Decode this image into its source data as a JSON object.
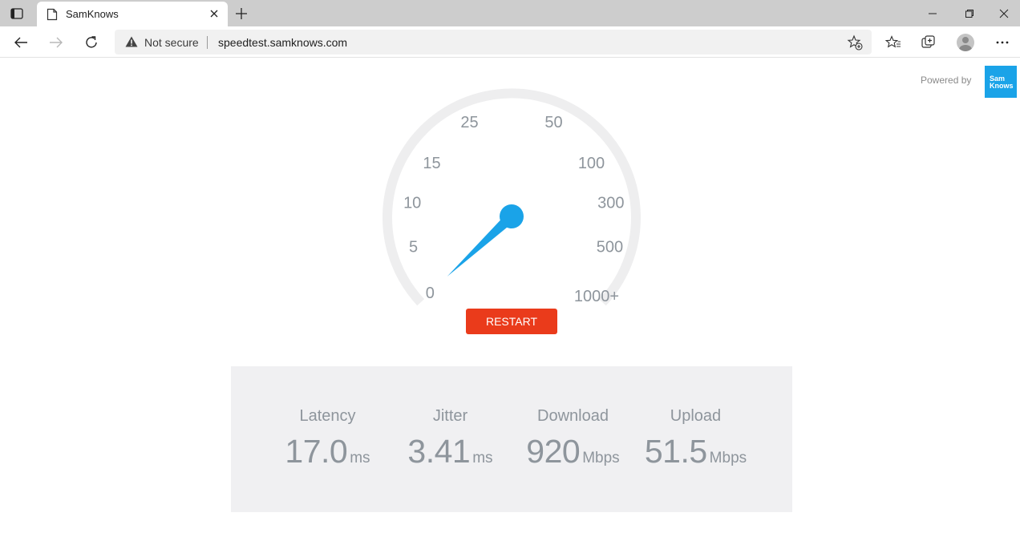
{
  "browser": {
    "tab_title": "SamKnows",
    "security_label": "Not secure",
    "url": "speedtest.samknows.com"
  },
  "icons": {
    "tab_actions": "tab-actions-icon",
    "favicon": "page-icon",
    "close": "close-icon",
    "new_tab": "plus-icon",
    "back": "back-arrow-icon",
    "forward": "forward-arrow-icon",
    "refresh": "refresh-icon",
    "warning": "warning-icon",
    "add_favorite": "add-favorite-icon",
    "favorites": "favorites-icon",
    "collections": "collections-icon",
    "profile": "profile-avatar-icon",
    "menu": "more-icon"
  },
  "page": {
    "powered_by": "Powered by",
    "logo_text_line1": "Sam",
    "logo_text_line2": "Knows",
    "restart_label": "RESTART"
  },
  "gauge": {
    "scale_labels": [
      "0",
      "5",
      "10",
      "15",
      "25",
      "50",
      "100",
      "300",
      "500",
      "1000+"
    ],
    "needle_fraction": 0.0,
    "needle_color": "#1aa3e8",
    "track_color": "#eeeeef"
  },
  "results": [
    {
      "label": "Latency",
      "value": "17.0",
      "unit": "ms"
    },
    {
      "label": "Jitter",
      "value": "3.41",
      "unit": "ms"
    },
    {
      "label": "Download",
      "value": "920",
      "unit": "Mbps"
    },
    {
      "label": "Upload",
      "value": "51.5",
      "unit": "Mbps"
    }
  ],
  "colors": {
    "accent_blue": "#1aa3e8",
    "restart_red": "#ea3b1b",
    "panel_bg": "#f0f0f2",
    "metric_text": "#8e959c"
  }
}
